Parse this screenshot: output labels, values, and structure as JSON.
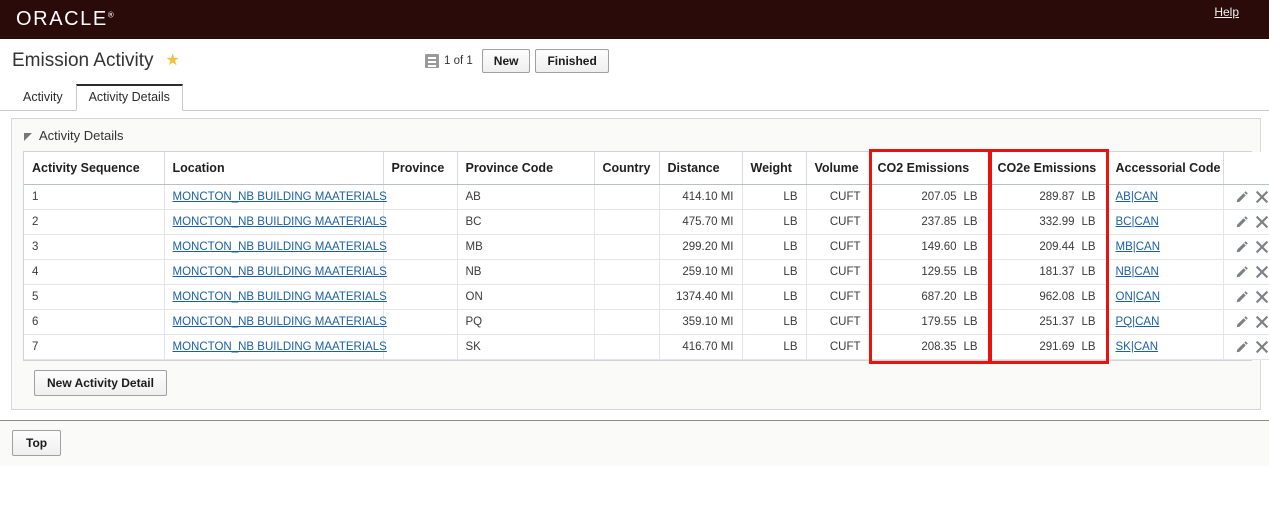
{
  "brand": {
    "logo_text": "ORACLE",
    "trademark": "®",
    "help_label": "Help"
  },
  "header": {
    "page_title": "Emission Activity",
    "star_icon": "star-icon",
    "list_icon": "list-icon",
    "record_count": "1 of 1",
    "new_label": "New",
    "finished_label": "Finished"
  },
  "tabs": [
    {
      "label": "Activity",
      "active": false
    },
    {
      "label": "Activity Details",
      "active": true
    }
  ],
  "panel": {
    "title": "Activity Details",
    "disclosure_icon": "triangle-collapse-icon",
    "new_detail_label": "New Activity Detail"
  },
  "table": {
    "columns": [
      "Activity Sequence",
      "Location",
      "Province",
      "Province Code",
      "Country",
      "Distance",
      "Weight",
      "Volume",
      "CO2 Emissions",
      "CO2e Emissions",
      "Accessorial Code",
      ""
    ],
    "rows": [
      {
        "seq": "1",
        "location": "MONCTON_NB BUILDING MAATERIALS",
        "province": "",
        "province_code": "AB",
        "country": "",
        "distance": "414.10 MI",
        "weight": "LB",
        "volume": "CUFT",
        "co2_value": "207.05",
        "co2_unit": "LB",
        "co2e_value": "289.87",
        "co2e_unit": "LB",
        "accessorial_code": "AB|CAN"
      },
      {
        "seq": "2",
        "location": "MONCTON_NB BUILDING MAATERIALS",
        "province": "",
        "province_code": "BC",
        "country": "",
        "distance": "475.70 MI",
        "weight": "LB",
        "volume": "CUFT",
        "co2_value": "237.85",
        "co2_unit": "LB",
        "co2e_value": "332.99",
        "co2e_unit": "LB",
        "accessorial_code": "BC|CAN"
      },
      {
        "seq": "3",
        "location": "MONCTON_NB BUILDING MAATERIALS",
        "province": "",
        "province_code": "MB",
        "country": "",
        "distance": "299.20 MI",
        "weight": "LB",
        "volume": "CUFT",
        "co2_value": "149.60",
        "co2_unit": "LB",
        "co2e_value": "209.44",
        "co2e_unit": "LB",
        "accessorial_code": "MB|CAN"
      },
      {
        "seq": "4",
        "location": "MONCTON_NB BUILDING MAATERIALS",
        "province": "",
        "province_code": "NB",
        "country": "",
        "distance": "259.10 MI",
        "weight": "LB",
        "volume": "CUFT",
        "co2_value": "129.55",
        "co2_unit": "LB",
        "co2e_value": "181.37",
        "co2e_unit": "LB",
        "accessorial_code": "NB|CAN"
      },
      {
        "seq": "5",
        "location": "MONCTON_NB BUILDING MAATERIALS",
        "province": "",
        "province_code": "ON",
        "country": "",
        "distance": "1374.40 MI",
        "weight": "LB",
        "volume": "CUFT",
        "co2_value": "687.20",
        "co2_unit": "LB",
        "co2e_value": "962.08",
        "co2e_unit": "LB",
        "accessorial_code": "ON|CAN"
      },
      {
        "seq": "6",
        "location": "MONCTON_NB BUILDING MAATERIALS",
        "province": "",
        "province_code": "PQ",
        "country": "",
        "distance": "359.10 MI",
        "weight": "LB",
        "volume": "CUFT",
        "co2_value": "179.55",
        "co2_unit": "LB",
        "co2e_value": "251.37",
        "co2e_unit": "LB",
        "accessorial_code": "PQ|CAN"
      },
      {
        "seq": "7",
        "location": "MONCTON_NB BUILDING MAATERIALS",
        "province": "",
        "province_code": "SK",
        "country": "",
        "distance": "416.70 MI",
        "weight": "LB",
        "volume": "CUFT",
        "co2_value": "208.35",
        "co2_unit": "LB",
        "co2e_value": "291.69",
        "co2e_unit": "LB",
        "accessorial_code": "SK|CAN"
      }
    ],
    "row_action_icons": [
      "edit-pencil-icon",
      "delete-x-icon"
    ]
  },
  "footer": {
    "top_label": "Top"
  },
  "colors": {
    "brand_bar": "#2b0a0a",
    "highlight": "#e8120e",
    "link": "#1a5fa8",
    "star": "#f0c040"
  }
}
